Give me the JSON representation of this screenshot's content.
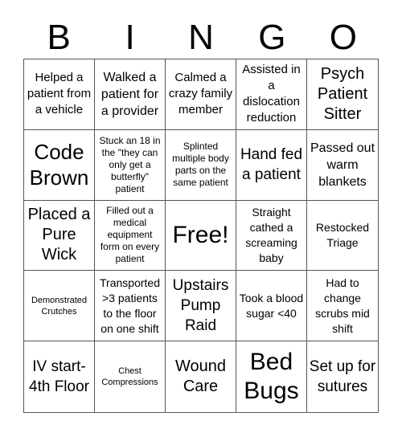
{
  "header": [
    "B",
    "I",
    "N",
    "G",
    "O"
  ],
  "cells": [
    "Helped a patient from a vehicle",
    "Walked a patient for a provider",
    "Calmed a crazy family member",
    "Assisted in a dislocation reduction",
    "Psych Patient Sitter",
    "Code Brown",
    "Stuck an 18 in the \"they can only get a butterfly\" patient",
    "Splinted multiple body parts on the same patient",
    "Hand fed a patient",
    "Passed out warm blankets",
    "Placed a Pure Wick",
    "Filled out a medical equipment form on every patient",
    "Free!",
    "Straight cathed a screaming baby",
    "Restocked Triage",
    "Demonstrated Crutches",
    "Transported >3 patients to the floor on one shift",
    "Upstairs Pump Raid",
    "Took a blood sugar <40",
    "Had to change scrubs mid shift",
    "IV start-4th Floor",
    "Chest Compressions",
    "Wound Care",
    "Bed Bugs",
    "Set up for sutures"
  ]
}
